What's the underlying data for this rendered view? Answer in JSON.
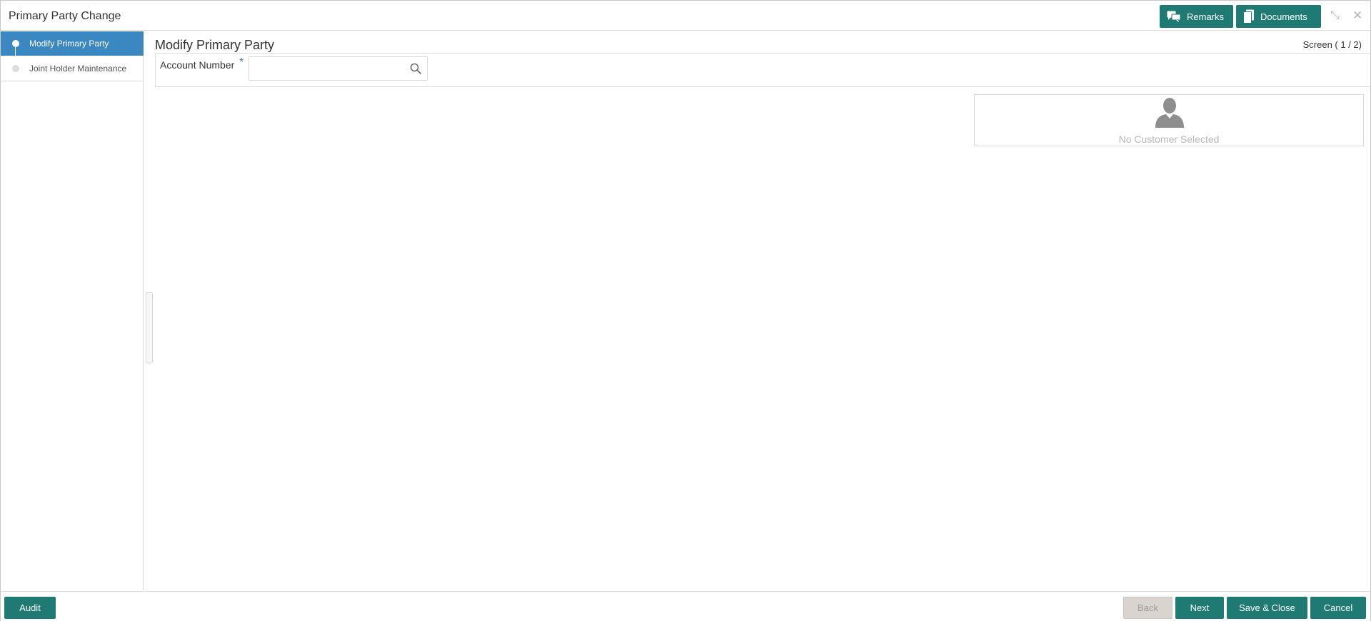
{
  "header": {
    "title": "Primary Party Change",
    "remarks_label": "Remarks",
    "documents_label": "Documents",
    "minimize_glyph": "⤡",
    "close_glyph": "✕"
  },
  "sidebar": {
    "steps": [
      {
        "label": "Modify Primary Party",
        "active": true
      },
      {
        "label": "Joint Holder Maintenance",
        "active": false
      }
    ]
  },
  "main": {
    "page_title": "Modify Primary Party",
    "screen_indicator": "Screen ( 1 / 2)",
    "account_number": {
      "label": "Account Number",
      "required_mark": "*",
      "value": "",
      "placeholder": ""
    },
    "customer_card": {
      "empty_text": "No Customer Selected"
    }
  },
  "footer": {
    "audit_label": "Audit",
    "back_label": "Back",
    "next_label": "Next",
    "save_close_label": "Save & Close",
    "cancel_label": "Cancel"
  },
  "colors": {
    "primary_button": "#1f7a74",
    "active_step": "#3b87c2",
    "disabled_button": "#d9d4cf"
  },
  "icons": {
    "remarks": "chat-bubbles-icon",
    "documents": "documents-icon",
    "search": "search-icon",
    "avatar": "user-avatar-icon"
  }
}
